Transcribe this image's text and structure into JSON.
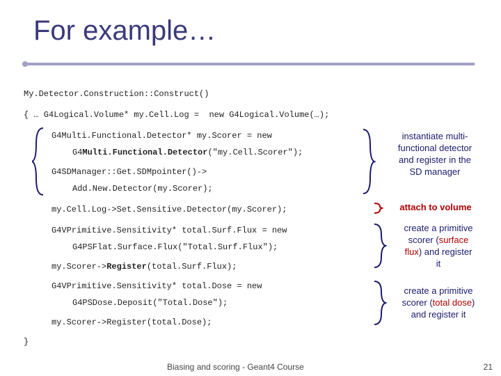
{
  "title": "For example…",
  "code": {
    "l1": "My.Detector.Construction::Construct()",
    "l2a": "{ …  G4Logical.Volume* my.Cell.Log =",
    "l2b": "new G4Logical.Volume(…);",
    "l3": "G4Multi.Functional.Detector* my.Scorer = new",
    "l4a": "G4",
    "l4b": "Multi.Functional.Detector",
    "l4c": "(\"my.Cell.Scorer\");",
    "l5": "G4SDManager::Get.SDMpointer()->",
    "l6": "Add.New.Detector(my.Scorer);",
    "l7": "my.Cell.Log->Set.Sensitive.Detector(my.Scorer);",
    "l8": "G4VPrimitive.Sensitivity* total.Surf.Flux = new",
    "l9": "G4PSFlat.Surface.Flux(\"Total.Surf.Flux\");",
    "l10a": "my.Scorer->",
    "l10b": "Register",
    "l10c": "(total.Surf.Flux);",
    "l11": "G4VPrimitive.Sensitivity* total.Dose = new",
    "l12": "G4PSDose.Deposit(\"Total.Dose\");",
    "l13": "my.Scorer->Register(total.Dose);",
    "l14": "}"
  },
  "ann": {
    "a1_l1": "instantiate multi-",
    "a1_l2": "functional detector",
    "a1_l3": "and register in the",
    "a1_l4": "SD manager",
    "a2": "attach to volume",
    "a3_l1": "create a primitive",
    "a3_l2a": "scorer (",
    "a3_l2b": "surface",
    "a3_l3a": "flux",
    "a3_l3b": ") and register",
    "a3_l4": "it",
    "a4_l1": "create a primitive",
    "a4_l2a": "scorer (",
    "a4_l2b": "total dose",
    "a4_l2c": ")",
    "a4_l3": "and register it"
  },
  "footer": {
    "center": "Biasing and scoring - Geant4 Course",
    "page": "21"
  }
}
